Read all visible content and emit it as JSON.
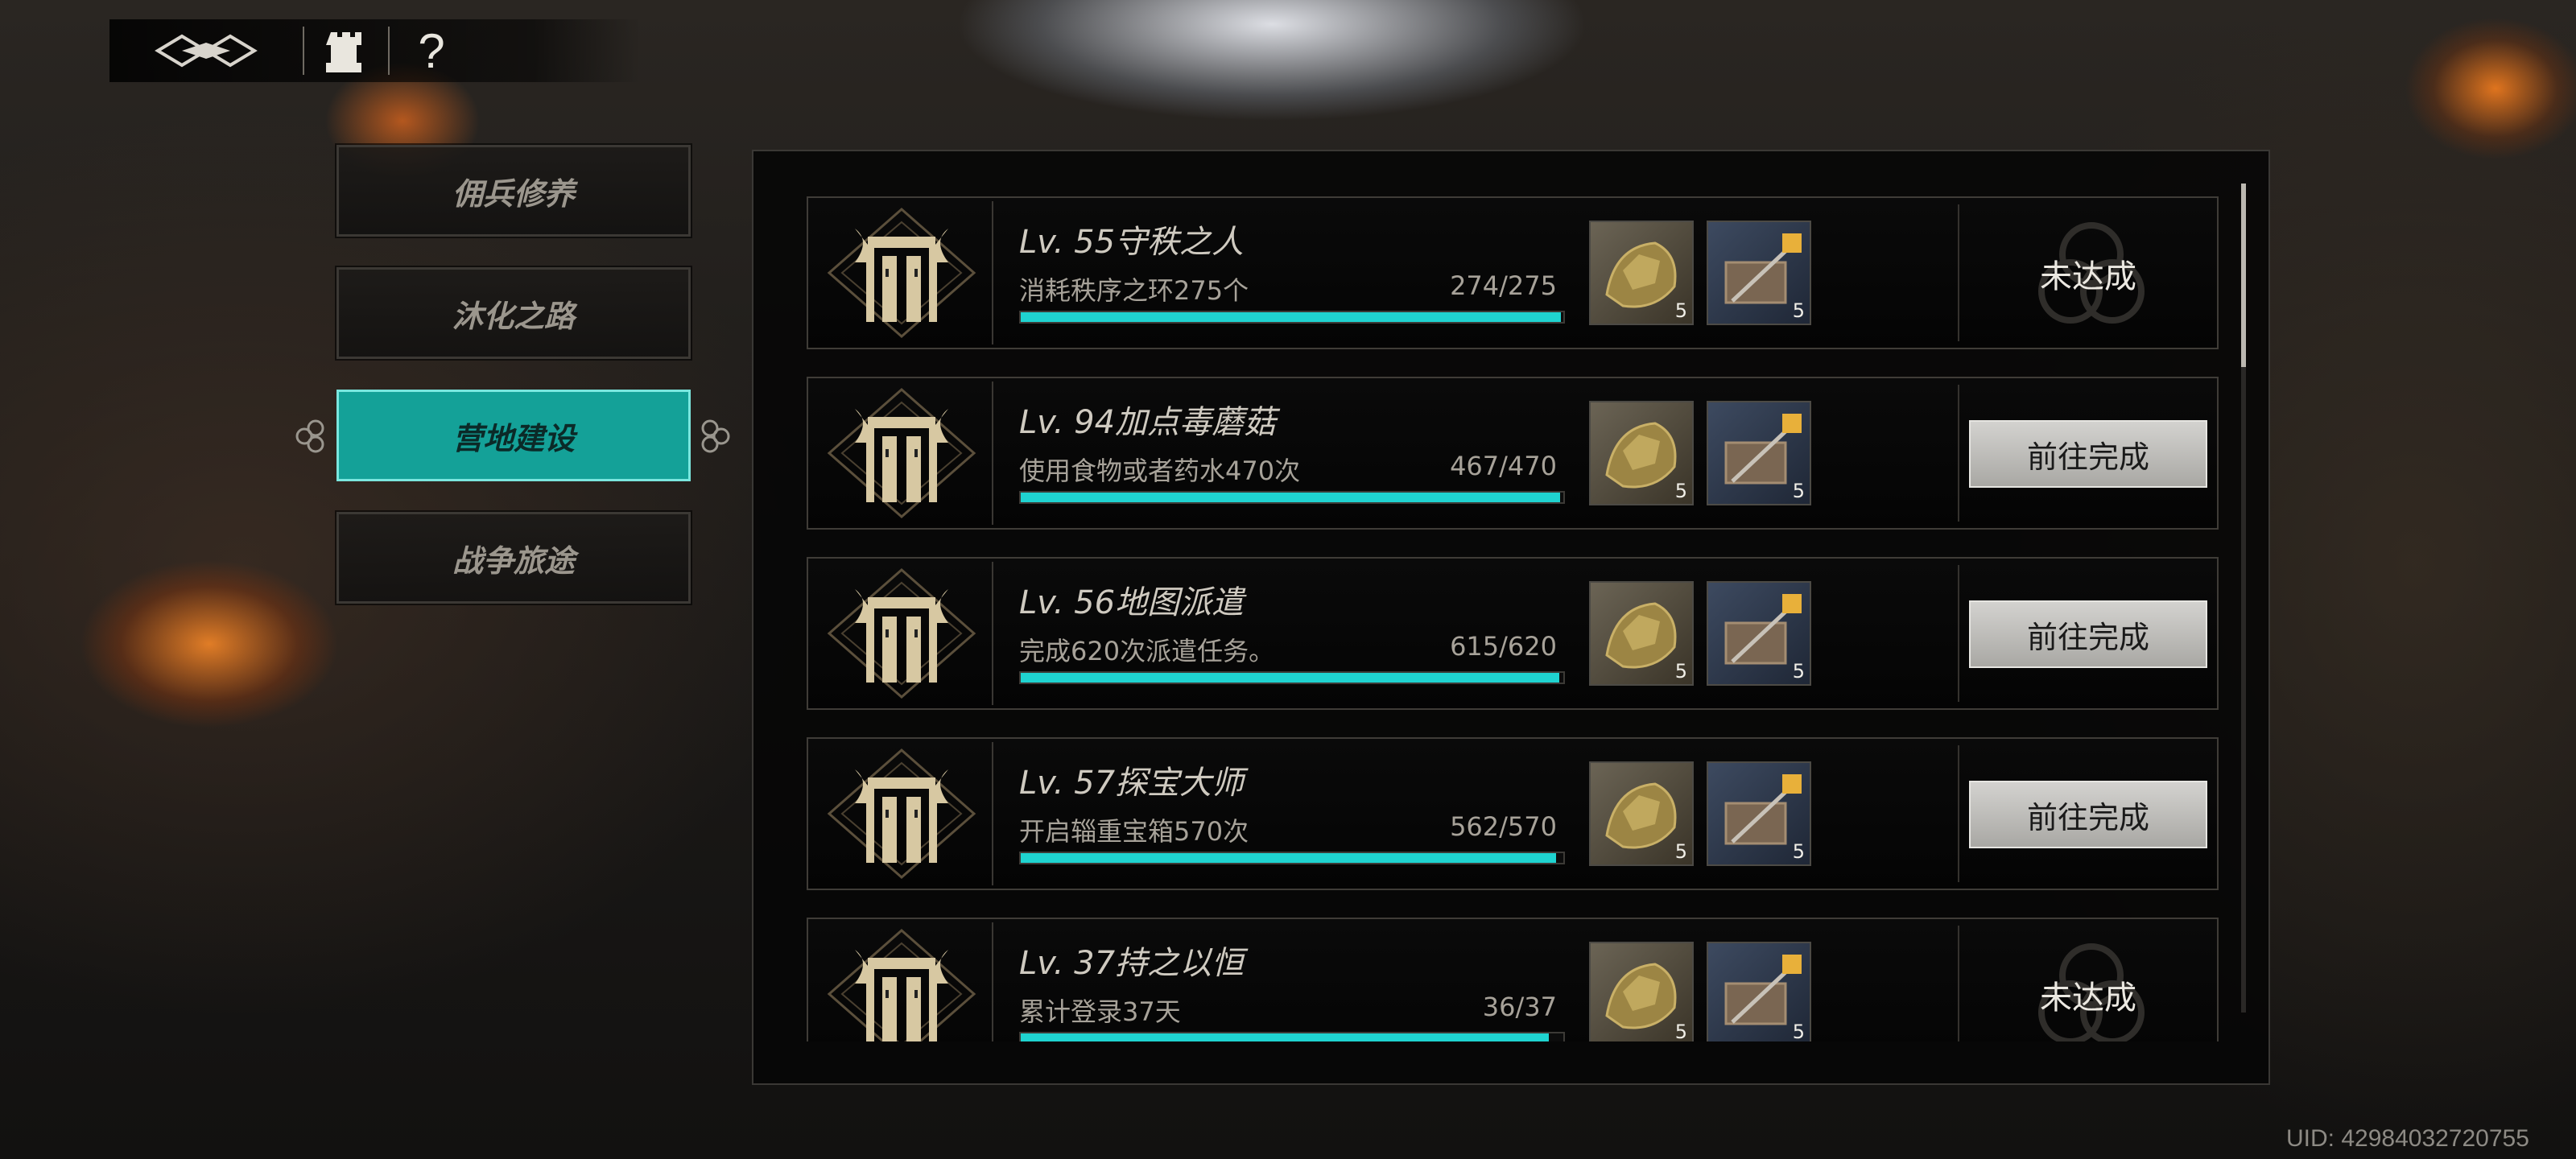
{
  "topbar": {
    "logo_icon": "game-logo-icon",
    "castle_icon": "castle-tower-icon",
    "help_label": "?"
  },
  "nav": {
    "items": [
      {
        "label": "佣兵修养",
        "active": false
      },
      {
        "label": "沐化之路",
        "active": false
      },
      {
        "label": "营地建设",
        "active": true
      },
      {
        "label": "战争旅途",
        "active": false
      }
    ]
  },
  "colors": {
    "accent": "#14a198",
    "progress": "#1fd3d0"
  },
  "tasks": [
    {
      "title": "Lv. 55守秩之人",
      "desc": "消耗秩序之环275个",
      "progress_text": "274/275",
      "progress": 0.996,
      "rewards": [
        {
          "icon": "gold-ore-icon",
          "qty": "5"
        },
        {
          "icon": "supply-crate-icon",
          "qty": "5"
        }
      ],
      "status": "未达成",
      "action": null
    },
    {
      "title": "Lv. 94加点毒蘑菇",
      "desc": "使用食物或者药水470次",
      "progress_text": "467/470",
      "progress": 0.994,
      "rewards": [
        {
          "icon": "gold-ore-icon",
          "qty": "5"
        },
        {
          "icon": "supply-crate-icon",
          "qty": "5"
        }
      ],
      "status": null,
      "action": "前往完成"
    },
    {
      "title": "Lv. 56地图派遣",
      "desc": "完成620次派遣任务。",
      "progress_text": "615/620",
      "progress": 0.992,
      "rewards": [
        {
          "icon": "gold-ore-icon",
          "qty": "5"
        },
        {
          "icon": "supply-crate-icon",
          "qty": "5"
        }
      ],
      "status": null,
      "action": "前往完成"
    },
    {
      "title": "Lv. 57探宝大师",
      "desc": "开启辎重宝箱570次",
      "progress_text": "562/570",
      "progress": 0.986,
      "rewards": [
        {
          "icon": "gold-ore-icon",
          "qty": "5"
        },
        {
          "icon": "supply-crate-icon",
          "qty": "5"
        }
      ],
      "status": null,
      "action": "前往完成"
    },
    {
      "title": "Lv. 37持之以恒",
      "desc": "累计登录37天",
      "progress_text": "36/37",
      "progress": 0.973,
      "rewards": [
        {
          "icon": "gold-ore-icon",
          "qty": "5"
        },
        {
          "icon": "supply-crate-icon",
          "qty": "5"
        }
      ],
      "status": "未达成",
      "action": null
    }
  ],
  "scroll": {
    "position": 0.0,
    "visible_fraction": 0.22
  },
  "uid": "UID: 42984032720755"
}
